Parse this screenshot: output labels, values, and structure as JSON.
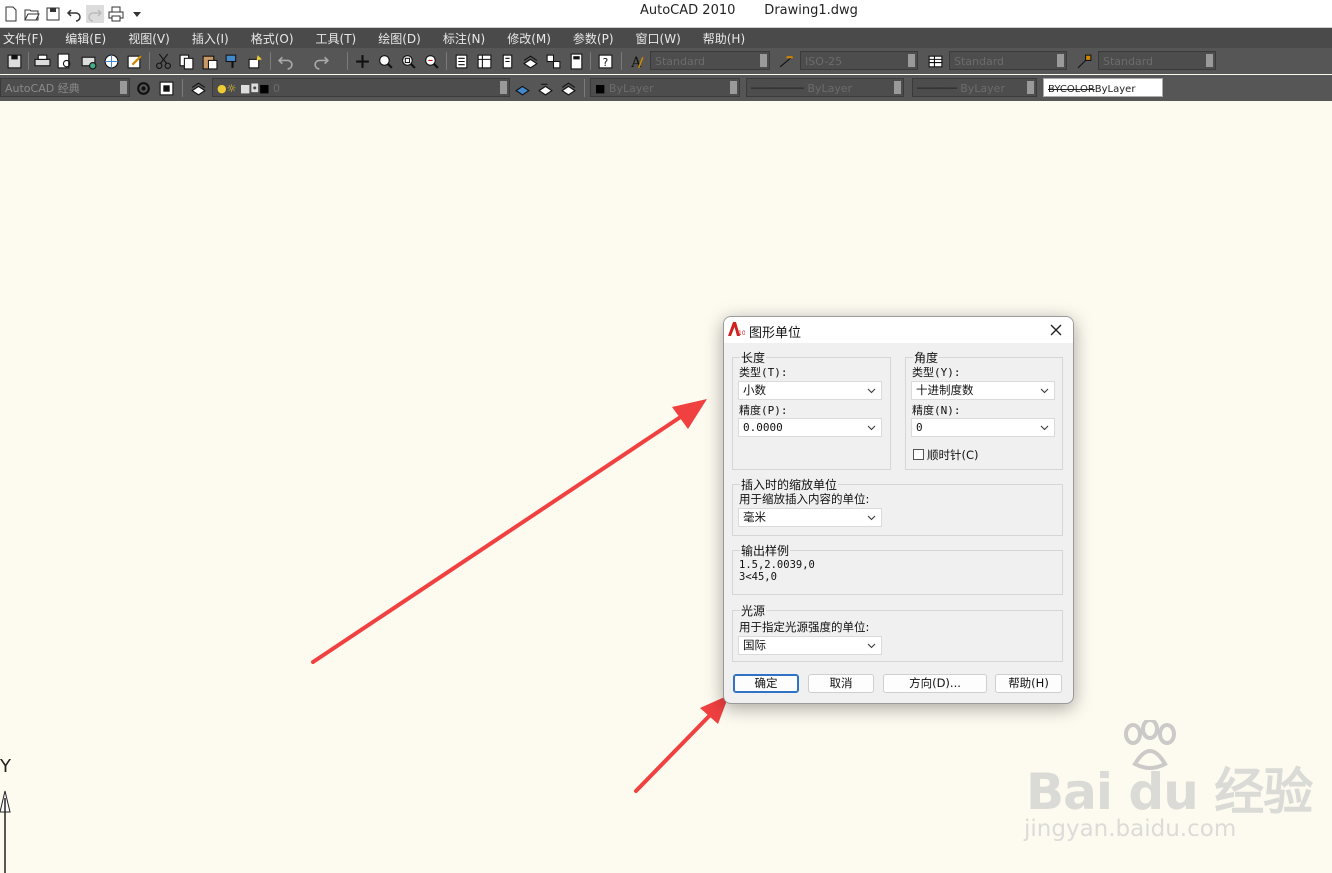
{
  "window": {
    "title": "AutoCAD 2010       Drawing1.dwg"
  },
  "quick_access": {
    "icons": [
      "new-icon",
      "open-icon",
      "save-icon",
      "undo-icon",
      "redo-icon",
      "plot-icon"
    ]
  },
  "menu": {
    "items": [
      "文件(F)",
      "编辑(E)",
      "视图(V)",
      "插入(I)",
      "格式(O)",
      "工具(T)",
      "绘图(D)",
      "标注(N)",
      "修改(M)",
      "参数(P)",
      "窗口(W)",
      "帮助(H)"
    ]
  },
  "toolbar1": {
    "text_style": "Standard",
    "dim_style": "ISO-25",
    "table_style": "Standard",
    "mleader_style": "Standard"
  },
  "toolbar2": {
    "workspace": "AutoCAD 经典",
    "layer": "0",
    "color": "ByLayer",
    "linetype": "ByLayer",
    "lineweight": "ByLayer",
    "plotstyle": "BYCOLOR",
    "plotstyle2": "ByLayer"
  },
  "dialog": {
    "title": "图形单位",
    "length": {
      "group_title": "长度",
      "type_label": "类型(T):",
      "type_value": "小数",
      "precision_label": "精度(P):",
      "precision_value": "0.0000"
    },
    "angle": {
      "group_title": "角度",
      "type_label": "类型(Y):",
      "type_value": "十进制度数",
      "precision_label": "精度(N):",
      "precision_value": "0",
      "clockwise_label": "顺时针(C)",
      "clockwise_checked": false
    },
    "insertion": {
      "group_title": "插入时的缩放单位",
      "label": "用于缩放插入内容的单位:",
      "value": "毫米"
    },
    "sample": {
      "group_title": "输出样例",
      "line1": "1.5,2.0039,0",
      "line2": "3<45,0"
    },
    "lighting": {
      "group_title": "光源",
      "label": "用于指定光源强度的单位:",
      "value": "国际"
    },
    "buttons": {
      "ok": "确定",
      "cancel": "取消",
      "direction": "方向(D)...",
      "help": "帮助(H)"
    }
  },
  "ucs": {
    "y_label": "Y"
  },
  "watermark": {
    "brand": "Bai du 经验",
    "url": "jingyan.baidu.com"
  },
  "colors": {
    "arrow": "#f04040",
    "canvas": "#fdfbf0",
    "menubar": "#4a4a4a",
    "toolbar": "#565656",
    "accent": "#3072c4"
  }
}
